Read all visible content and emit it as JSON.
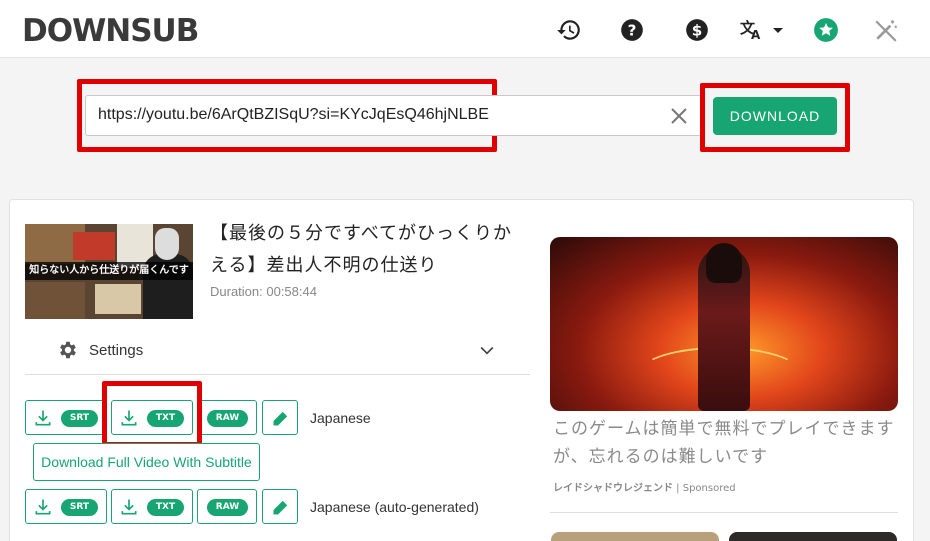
{
  "header": {
    "logo": "DOWNSUB",
    "icons": [
      "history-icon",
      "help-icon",
      "dollar-icon",
      "translate-icon",
      "star-icon",
      "magic-wand-off-icon"
    ]
  },
  "search": {
    "url_value": "https://youtu.be/6ArQtBZISqU?si=KYcJqEsQ46hjNLBE",
    "download_label": "DOWNLOAD"
  },
  "video": {
    "thumbnail_caption": "知らない人から仕送りが届くんです",
    "title": "【最後の５分ですべてがひっくりかえる】差出人不明の仕送り",
    "duration": "Duration: 00:58:44"
  },
  "settings": {
    "label": "Settings"
  },
  "subtitles": [
    {
      "language": "Japanese",
      "srt": "SRT",
      "txt": "TXT",
      "raw": "RAW"
    },
    {
      "language": "Japanese (auto-generated)",
      "srt": "SRT",
      "txt": "TXT",
      "raw": "RAW"
    }
  ],
  "full_video_label": "Download Full Video With Subtitle",
  "ad": {
    "text": "このゲームは簡単で無料でプレイできますが、忘れるのは難しいです",
    "source_name": "レイドシャドウレジェンド",
    "source_suffix": " | Sponsored"
  },
  "colors": {
    "accent": "#17a673",
    "highlight": "#e00000"
  }
}
